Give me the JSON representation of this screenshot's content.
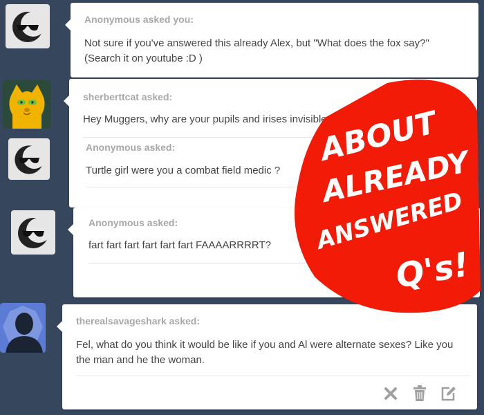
{
  "posts": [
    {
      "asker": "Anonymous asked you:",
      "question": "Not sure if you've answered this already Alex, but \"What does the fox say?\" (Search it on youtube :D )"
    },
    {
      "asker": "sherberttcat asked:",
      "question": "Hey Muggers, why are your pupils and irises invisible?"
    },
    {
      "asker": "Anonymous asked:",
      "question": "Turtle girl were you a combat field medic ?"
    },
    {
      "asker": "Anonymous asked:",
      "question": "fart fart fart fart fart fart FAAAARRRRT?"
    },
    {
      "asker": "therealsavageshark asked:",
      "question": "Fel, what do you think it would be like if you and Al were alternate sexes? Like you the man and he the woman."
    }
  ],
  "overlay": {
    "line1": "ABOUT",
    "line2": "ALREADY",
    "line3": "ANSWERED",
    "line4": "Q's!"
  },
  "colors": {
    "background": "#36465d",
    "stamp": "#f21b08",
    "asker_text": "#a8a8a8"
  },
  "icons": [
    "sunglasses-moon-avatar",
    "yellow-cat-avatar",
    "default-silhouette-avatar",
    "close-icon",
    "trash-icon",
    "edit-icon"
  ]
}
